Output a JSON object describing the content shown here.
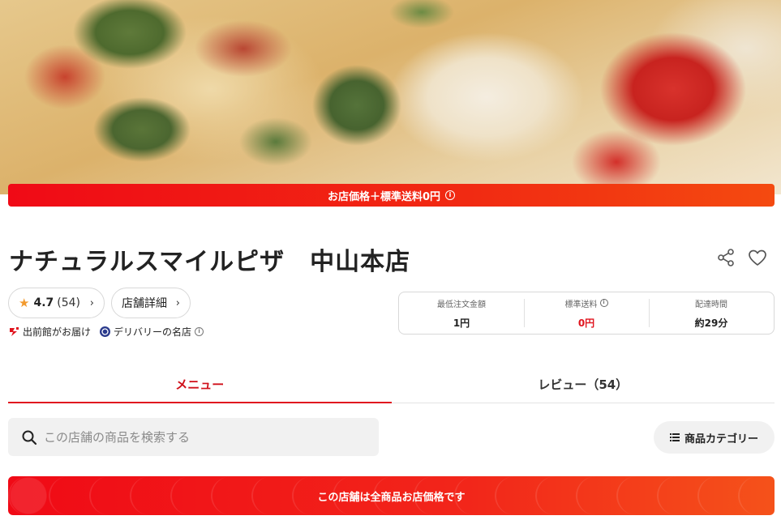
{
  "promo_banner": {
    "text": "お店価格＋標準送料0円"
  },
  "store": {
    "name": "ナチュラルスマイルピザ　中山本店"
  },
  "rating": {
    "value": "4.7",
    "count": "(54)"
  },
  "details_label": "店舗詳細",
  "badges": {
    "demae": "出前館がお届け",
    "famous": "デリバリーの名店"
  },
  "delivery_info": [
    {
      "label": "最低注文金額",
      "value": "1円"
    },
    {
      "label": "標準送料",
      "value": "0円"
    },
    {
      "label": "配達時間",
      "value": "約29分"
    }
  ],
  "tabs": [
    {
      "label": "メニュー",
      "active": true
    },
    {
      "label": "レビュー（54）",
      "active": false
    }
  ],
  "search": {
    "placeholder": "この店舗の商品を検索する"
  },
  "category_button": {
    "label": "商品カテゴリー"
  },
  "bottom_banner": {
    "text": "この店舗は全商品お店価格です"
  },
  "colors": {
    "brand_red": "#e0141e",
    "star": "#f29a2e"
  }
}
